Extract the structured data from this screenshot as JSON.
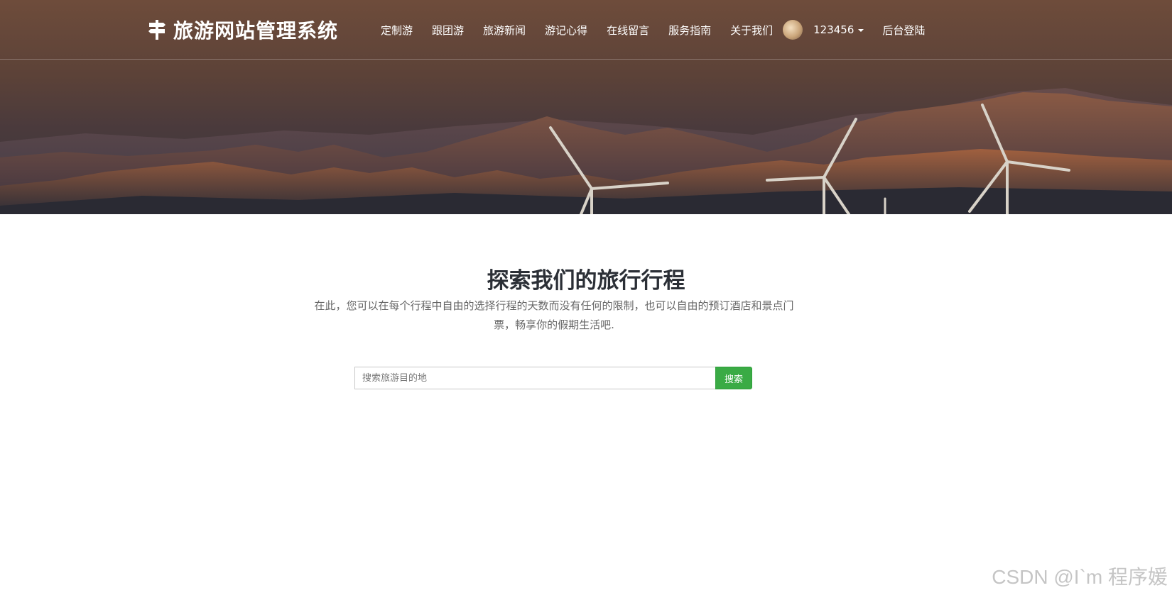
{
  "brand": {
    "title": "旅游网站管理系统",
    "icon": "signpost-icon"
  },
  "nav": {
    "items": [
      {
        "label": "定制游"
      },
      {
        "label": "跟团游"
      },
      {
        "label": "旅游新闻"
      },
      {
        "label": "游记心得"
      },
      {
        "label": "在线留言"
      },
      {
        "label": "服务指南"
      },
      {
        "label": "关于我们"
      }
    ],
    "user": {
      "name": "123456",
      "avatar_icon": "avatar"
    },
    "admin_login": "后台登陆"
  },
  "hero": {
    "image": "mountains-with-wind-turbines"
  },
  "main": {
    "title": "探索我们的旅行行程",
    "description": "在此，您可以在每个行程中自由的选择行程的天数而没有任何的限制，也可以自由的预订酒店和景点门票，畅享你的假期生活吧."
  },
  "search": {
    "placeholder": "搜索旅游目的地",
    "button_label": "搜索"
  },
  "watermark": "CSDN @I`m 程序媛",
  "colors": {
    "nav_bg": "#6b4a3a",
    "search_button": "#3aab45",
    "title_text": "#2b2f36"
  }
}
